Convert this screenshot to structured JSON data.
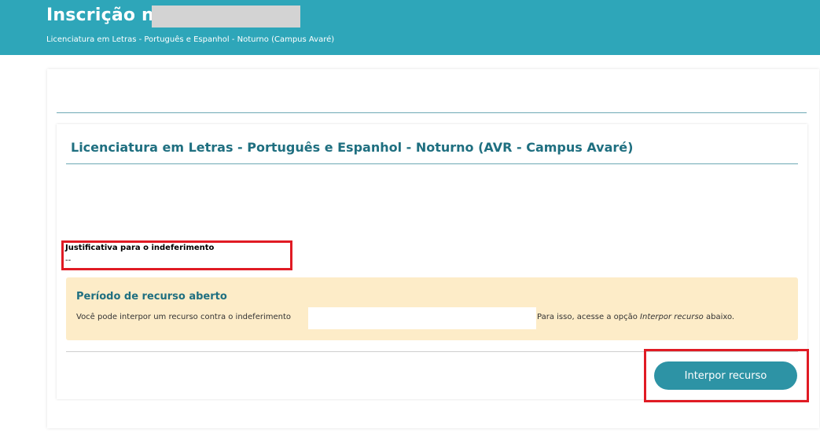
{
  "header": {
    "title": "Inscrição nº",
    "subtitle": "Licenciatura em Letras - Português e Espanhol - Noturno (Campus Avaré)"
  },
  "course_card": {
    "title": "Licenciatura em Letras - Português e Espanhol - Noturno (AVR - Campus Avaré)"
  },
  "justification": {
    "label": "Justificativa para o indeferimento",
    "value": "--"
  },
  "appeal_alert": {
    "title": "Período de recurso aberto",
    "text_before": "Você pode interpor um recurso contra o indeferimento",
    "text_after_prefix": "Para isso, acesse a opção ",
    "text_after_em": "Interpor recurso",
    "text_after_suffix": " abaixo."
  },
  "actions": {
    "appeal_button_label": "Interpor recurso"
  },
  "colors": {
    "header_bg": "#2ea6b9",
    "title_teal": "#1f6f80",
    "alert_bg": "#fdecc8",
    "button_bg": "#2d93a5",
    "annotation_red": "#e01b24"
  }
}
